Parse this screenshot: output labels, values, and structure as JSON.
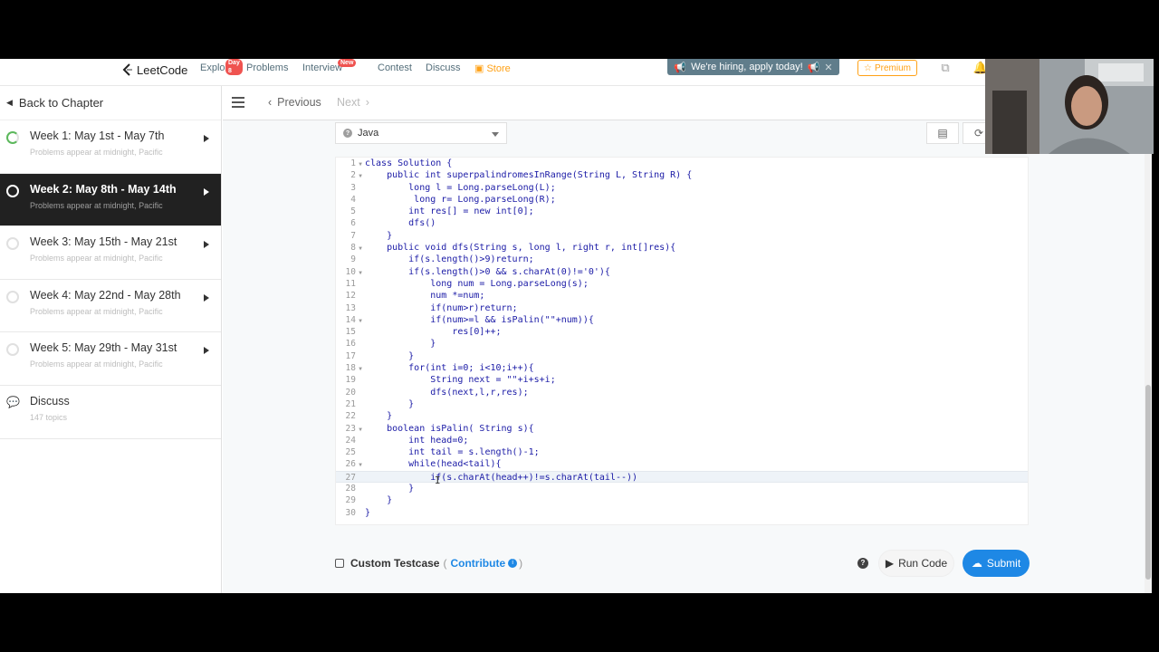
{
  "topnav": {
    "brand": "LeetCode",
    "items": [
      {
        "label": "Explore",
        "badge": "Day 8"
      },
      {
        "label": "Problems",
        "badge": ""
      },
      {
        "label": "Interview",
        "badge": "New"
      },
      {
        "label": "Contest",
        "badge": ""
      },
      {
        "label": "Discuss",
        "badge": ""
      },
      {
        "label": "Store",
        "badge": ""
      }
    ],
    "hiring": "We're hiring, apply today!",
    "premium": "Premium"
  },
  "sidebar": {
    "back_label": "Back to Chapter",
    "chapters": [
      {
        "title": "Week 1: May 1st - May 7th",
        "sub": "Problems appear at midnight, Pacific"
      },
      {
        "title": "Week 2: May 8th - May 14th",
        "sub": "Problems appear at midnight, Pacific"
      },
      {
        "title": "Week 3: May 15th - May 21st",
        "sub": "Problems appear at midnight, Pacific"
      },
      {
        "title": "Week 4: May 22nd - May 28th",
        "sub": "Problems appear at midnight, Pacific"
      },
      {
        "title": "Week 5: May 29th - May 31st",
        "sub": "Problems appear at midnight, Pacific"
      }
    ],
    "discuss": {
      "title": "Discuss",
      "sub": "147 topics"
    }
  },
  "toolbar": {
    "previous": "Previous",
    "next": "Next"
  },
  "editor": {
    "language": "Java",
    "lines": [
      "class Solution {",
      "    public int superpalindromesInRange(String L, String R) {",
      "        long l = Long.parseLong(L);",
      "         long r= Long.parseLong(R);",
      "        int res[] = new int[0];",
      "        dfs()",
      "    }",
      "    public void dfs(String s, long l, right r, int[]res){",
      "        if(s.length()>9)return;",
      "        if(s.length()>0 && s.charAt(0)!='0'){",
      "            long num = Long.parseLong(s);",
      "            num *=num;",
      "            if(num>r)return;",
      "            if(num>=l && isPalin(\"\"+num)){",
      "                res[0]++;",
      "            }",
      "        }",
      "        for(int i=0; i<10;i++){",
      "            String next = \"\"+i+s+i;",
      "            dfs(next,l,r,res);",
      "        }",
      "    }",
      "    boolean isPalin( String s){",
      "        int head=0;",
      "        int tail = s.length()-1;",
      "        while(head<tail){",
      "            if(s.charAt(head++)!=s.charAt(tail--))",
      "        }",
      "    }",
      "}"
    ]
  },
  "footer": {
    "custom_testcase": "Custom Testcase",
    "contribute": "Contribute",
    "run_code": "Run Code",
    "submit": "Submit"
  }
}
